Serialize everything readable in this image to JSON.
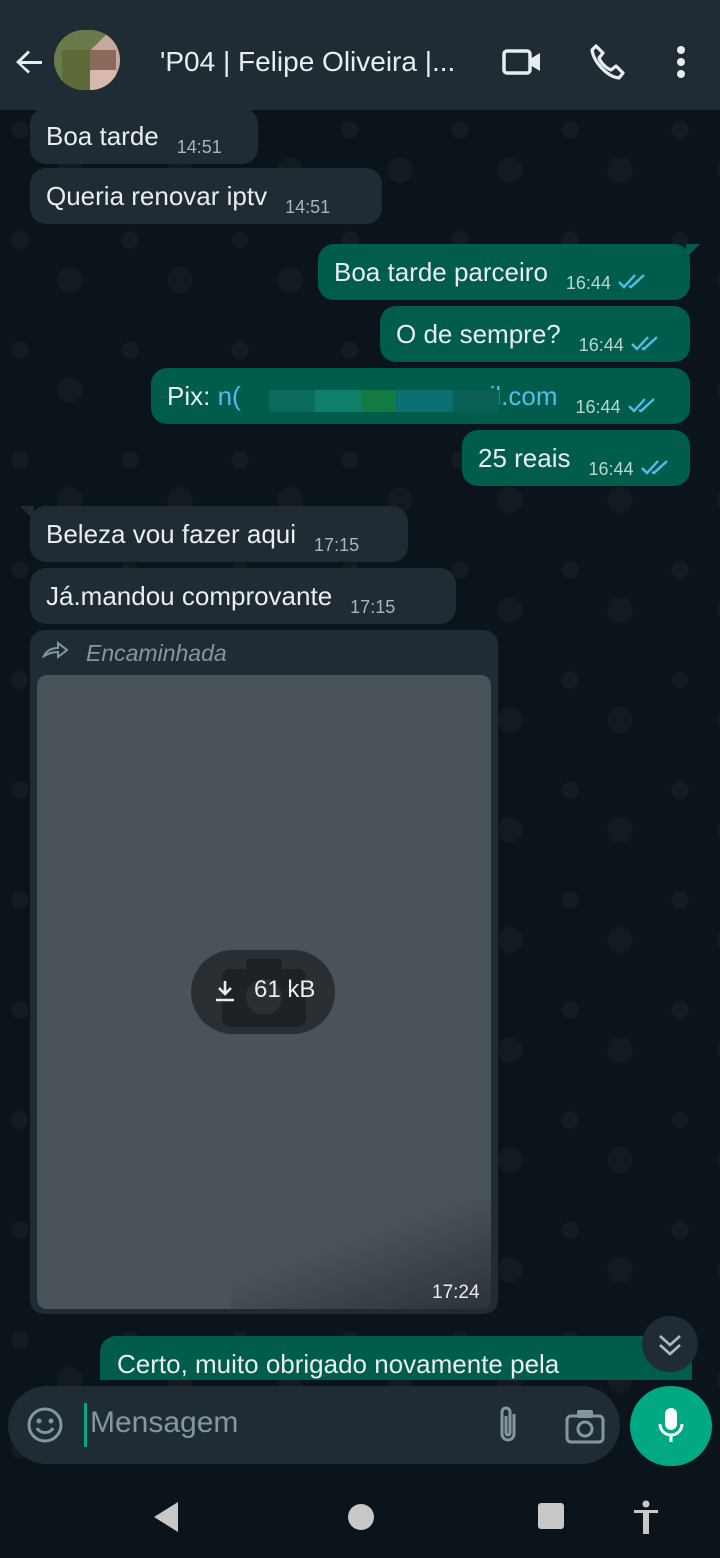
{
  "header": {
    "title": "'P04 | Felipe Oliveira |...",
    "back_icon": "arrow-left-icon",
    "video_icon": "video-camera-icon",
    "call_icon": "phone-icon",
    "menu_icon": "more-vertical-icon"
  },
  "messages": [
    {
      "direction": "incoming",
      "text": "Boa tarde",
      "time": "14:51"
    },
    {
      "direction": "incoming",
      "text": "Queria renovar iptv",
      "time": "14:51"
    },
    {
      "direction": "outgoing",
      "text": "Boa tarde parceiro",
      "time": "16:44",
      "status": "read"
    },
    {
      "direction": "outgoing",
      "text": "O de sempre?",
      "time": "16:44",
      "status": "read"
    },
    {
      "direction": "outgoing",
      "prefix": "Pix: ",
      "link_start": "n(",
      "link_end": "nail.com",
      "time": "16:44",
      "status": "read"
    },
    {
      "direction": "outgoing",
      "text": "25 reais",
      "time": "16:44",
      "status": "read"
    },
    {
      "direction": "incoming",
      "text": "Beleza vou fazer aqui",
      "time": "17:15"
    },
    {
      "direction": "incoming",
      "text": "Já.mandou comprovante",
      "time": "17:15"
    }
  ],
  "forwarded_image": {
    "label": "Encaminhada",
    "download_size": "61 kB",
    "time": "17:24"
  },
  "partial_message": {
    "text": "Certo, muito obrigado novamente pela"
  },
  "composer": {
    "placeholder": "Mensagem",
    "emoji_icon": "emoji-icon",
    "attach_icon": "paperclip-icon",
    "camera_icon": "camera-icon",
    "mic_icon": "microphone-icon"
  },
  "colors": {
    "header_bg": "#1f2c34",
    "chat_bg": "#0b141a",
    "incoming_bubble": "#1f2c34",
    "outgoing_bubble": "#005c4b",
    "accent": "#00a884",
    "read_ticks": "#53bdeb"
  }
}
